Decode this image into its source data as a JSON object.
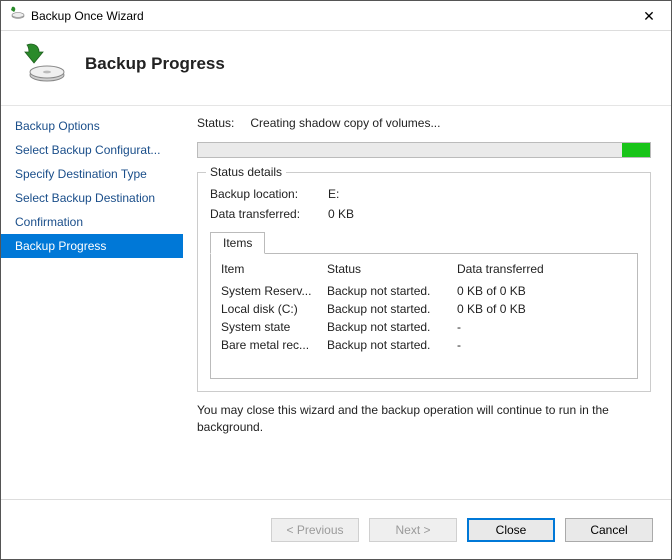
{
  "window": {
    "title": "Backup Once Wizard"
  },
  "header": {
    "title": "Backup Progress"
  },
  "sidebar": {
    "items": [
      {
        "label": "Backup Options"
      },
      {
        "label": "Select Backup Configurat..."
      },
      {
        "label": "Specify Destination Type"
      },
      {
        "label": "Select Backup Destination"
      },
      {
        "label": "Confirmation"
      },
      {
        "label": "Backup Progress"
      }
    ],
    "selected_index": 5
  },
  "main": {
    "status_label": "Status:",
    "status_value": "Creating shadow copy of volumes...",
    "details_title": "Status details",
    "backup_location_label": "Backup location:",
    "backup_location_value": "E:",
    "data_transferred_label": "Data transferred:",
    "data_transferred_value": "0 KB",
    "tab_label": "Items",
    "columns": {
      "item": "Item",
      "status": "Status",
      "data": "Data transferred"
    },
    "rows": [
      {
        "item": "System Reserv...",
        "status": "Backup not started.",
        "data": "0 KB of 0 KB"
      },
      {
        "item": "Local disk (C:)",
        "status": "Backup not started.",
        "data": "0 KB of 0 KB"
      },
      {
        "item": "System state",
        "status": "Backup not started.",
        "data": "-"
      },
      {
        "item": "Bare metal rec...",
        "status": "Backup not started.",
        "data": "-"
      }
    ],
    "note": "You may close this wizard and the backup operation will continue to run in the background."
  },
  "footer": {
    "previous": "< Previous",
    "next": "Next >",
    "close": "Close",
    "cancel": "Cancel"
  }
}
